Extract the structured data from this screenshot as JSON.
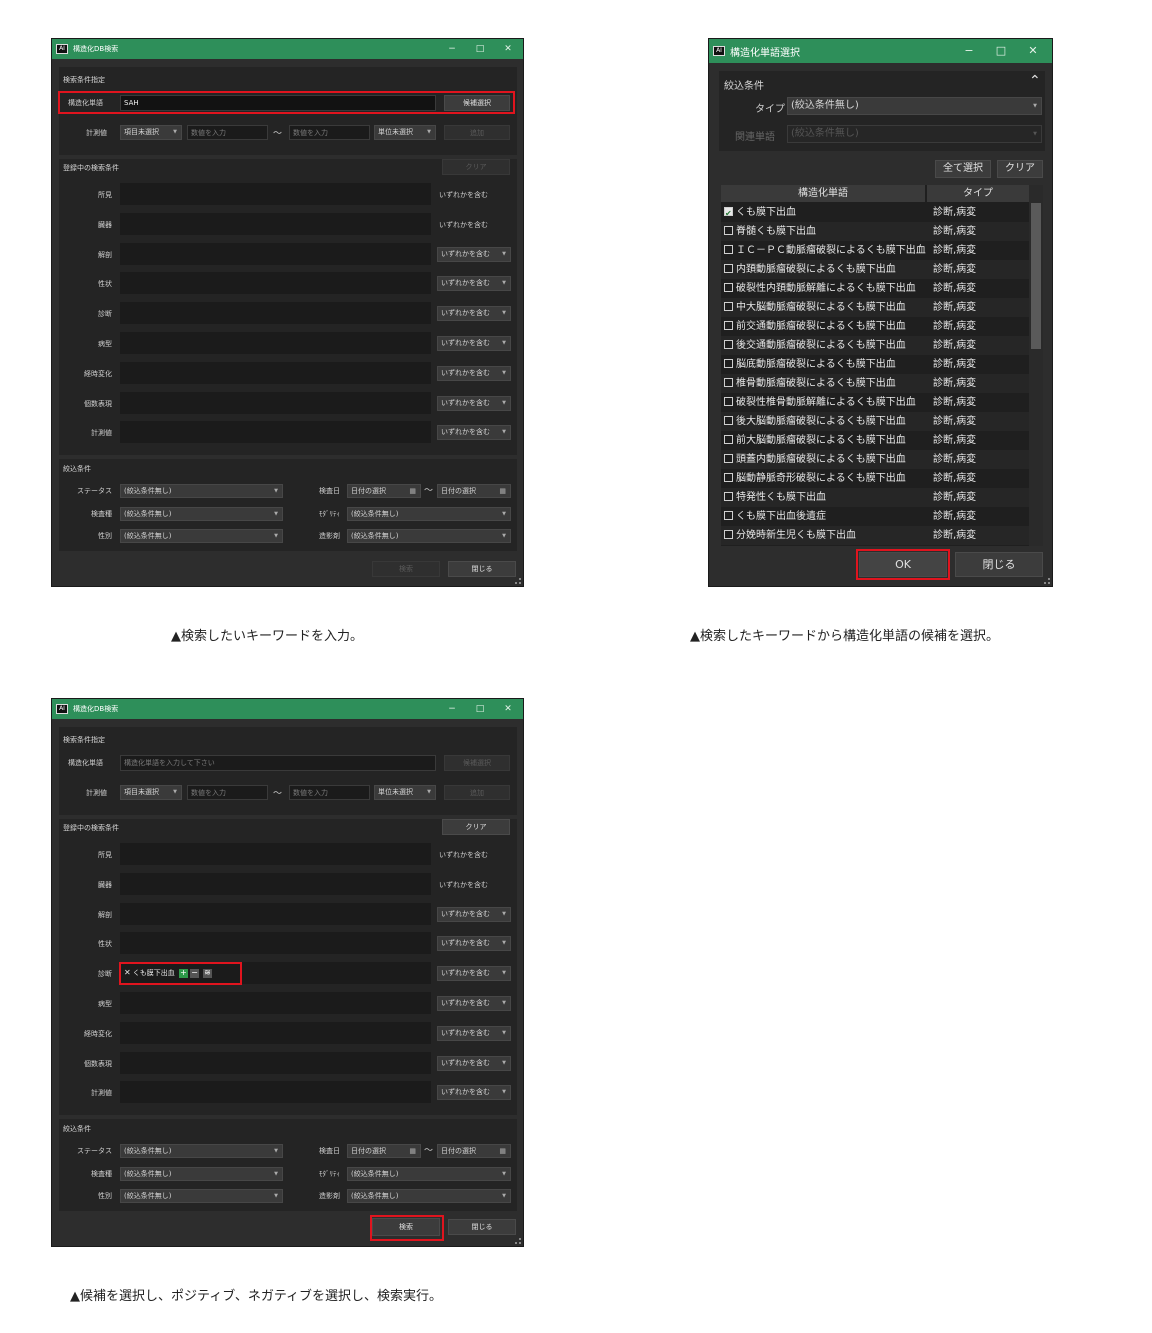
{
  "captions": {
    "c1": "▲検索したいキーワードを入力。",
    "c2": "▲検索したキーワードから構造化単語の候補を選択。",
    "c3": "▲候補を選択し、ポジティブ、ネガティブを選択し、検索実行。"
  },
  "search_window": {
    "title": "構造化DB検索",
    "controls": {
      "minimize": "−",
      "maximize": "□",
      "close": "✕"
    },
    "section_conditions": "検索条件指定",
    "structured_word_label": "構造化単語",
    "structured_word_value_step1": "SAH",
    "structured_word_placeholder": "構造化単語を入力して下さい",
    "candidate_button": "候補選択",
    "measure_label": "計測値",
    "item_select": "項目未選択",
    "number_placeholder": "数値を入力",
    "tilde": "～",
    "unit_select": "単位未選択",
    "add_button": "追加",
    "section_registered": "登録中の検索条件",
    "clear_button": "クリア",
    "conditions": [
      {
        "label": "所見",
        "mode": "いずれかを含む"
      },
      {
        "label": "臓器",
        "mode": "いずれかを含む"
      },
      {
        "label": "解剖",
        "mode": "いずれかを含む"
      },
      {
        "label": "性状",
        "mode": "いずれかを含む"
      },
      {
        "label": "診断",
        "mode": "いずれかを含む"
      },
      {
        "label": "病型",
        "mode": "いずれかを含む"
      },
      {
        "label": "経時変化",
        "mode": "いずれかを含む"
      },
      {
        "label": "個数表現",
        "mode": "いずれかを含む"
      },
      {
        "label": "計測値",
        "mode": "いずれかを含む"
      }
    ],
    "diagnosis_chip": {
      "remove": "✕",
      "text": "くも膜下出血",
      "plus": "+",
      "minus": "−",
      "extra": "≋"
    },
    "section_filter": "絞込条件",
    "status_label": "ステータス",
    "exam_type_label": "検査種",
    "sex_label": "性別",
    "no_filter": "(絞込条件無し)",
    "exam_date_label": "検査日",
    "date_select": "日付の選択",
    "calendar_icon": "▦",
    "modality_label": "ﾓﾀﾞﾘﾃｨ",
    "contrast_label": "造影剤",
    "search_button": "検索",
    "close_button": "閉じる"
  },
  "select_dialog": {
    "title": "構造化単語選択",
    "controls": {
      "minimize": "−",
      "maximize": "□",
      "close": "✕"
    },
    "filter_section": "絞込条件",
    "collapse_icon": "⌃",
    "type_label": "タイプ",
    "type_value": "(絞込条件無し)",
    "related_label": "関連単語",
    "related_value": "(絞込条件無し)",
    "select_all_button": "全て選択",
    "clear_button": "クリア",
    "col_word": "構造化単語",
    "col_type": "タイプ",
    "rows": [
      {
        "word": "くも膜下出血",
        "type": "診断,病変",
        "checked": true
      },
      {
        "word": "脊髄くも膜下出血",
        "type": "診断,病変",
        "checked": false
      },
      {
        "word": "ＩＣ－ＰＣ動脈瘤破裂によるくも膜下出血",
        "type": "診断,病変",
        "checked": false
      },
      {
        "word": "内頚動脈瘤破裂によるくも膜下出血",
        "type": "診断,病変",
        "checked": false
      },
      {
        "word": "破裂性内頚動脈解離によるくも膜下出血",
        "type": "診断,病変",
        "checked": false
      },
      {
        "word": "中大脳動脈瘤破裂によるくも膜下出血",
        "type": "診断,病変",
        "checked": false
      },
      {
        "word": "前交通動脈瘤破裂によるくも膜下出血",
        "type": "診断,病変",
        "checked": false
      },
      {
        "word": "後交通動脈瘤破裂によるくも膜下出血",
        "type": "診断,病変",
        "checked": false
      },
      {
        "word": "脳底動脈瘤破裂によるくも膜下出血",
        "type": "診断,病変",
        "checked": false
      },
      {
        "word": "椎骨動脈瘤破裂によるくも膜下出血",
        "type": "診断,病変",
        "checked": false
      },
      {
        "word": "破裂性椎骨動脈解離によるくも膜下出血",
        "type": "診断,病変",
        "checked": false
      },
      {
        "word": "後大脳動脈瘤破裂によるくも膜下出血",
        "type": "診断,病変",
        "checked": false
      },
      {
        "word": "前大脳動脈瘤破裂によるくも膜下出血",
        "type": "診断,病変",
        "checked": false
      },
      {
        "word": "頭蓋内動脈瘤破裂によるくも膜下出血",
        "type": "診断,病変",
        "checked": false
      },
      {
        "word": "脳動静脈奇形破裂によるくも膜下出血",
        "type": "診断,病変",
        "checked": false
      },
      {
        "word": "特発性くも膜下出血",
        "type": "診断,病変",
        "checked": false
      },
      {
        "word": "くも膜下出血後遺症",
        "type": "診断,病変",
        "checked": false
      },
      {
        "word": "分娩時新生児くも膜下出血",
        "type": "診断,病変",
        "checked": false
      }
    ],
    "ok_button": "OK",
    "close_button": "閉じる"
  },
  "colors": {
    "titlebar": "#2e8f5a",
    "highlight": "#e0141e",
    "panel": "#242424"
  }
}
